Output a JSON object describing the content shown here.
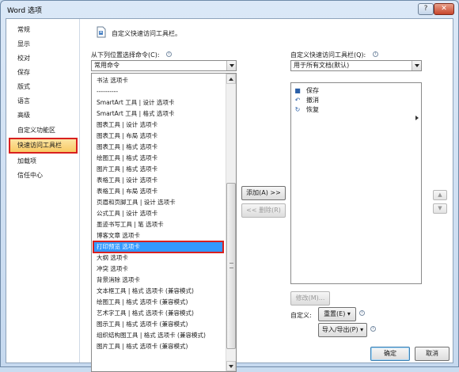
{
  "window": {
    "title": "Word 选项",
    "help_label": "?",
    "close_label": "✕"
  },
  "nav": {
    "items": [
      {
        "label": "常规",
        "selected": false
      },
      {
        "label": "显示",
        "selected": false
      },
      {
        "label": "校对",
        "selected": false
      },
      {
        "label": "保存",
        "selected": false
      },
      {
        "label": "版式",
        "selected": false
      },
      {
        "label": "语言",
        "selected": false
      },
      {
        "label": "高级",
        "selected": false
      },
      {
        "label": "自定义功能区",
        "selected": false
      },
      {
        "label": "快速访问工具栏",
        "selected": true
      },
      {
        "label": "加载项",
        "selected": false
      },
      {
        "label": "信任中心",
        "selected": false
      }
    ]
  },
  "header": {
    "title": "自定义快速访问工具栏。"
  },
  "left": {
    "choose_label": "从下列位置选择命令(C):",
    "choose_value": "常用命令",
    "list_items": [
      {
        "label": "书法 选项卡",
        "selected": false
      },
      {
        "label": "----------",
        "selected": false
      },
      {
        "label": "SmartArt 工具 | 设计 选项卡",
        "selected": false
      },
      {
        "label": "SmartArt 工具 | 格式 选项卡",
        "selected": false
      },
      {
        "label": "图表工具 | 设计 选项卡",
        "selected": false
      },
      {
        "label": "图表工具 | 布局 选项卡",
        "selected": false
      },
      {
        "label": "图表工具 | 格式 选项卡",
        "selected": false
      },
      {
        "label": "绘图工具 | 格式 选项卡",
        "selected": false
      },
      {
        "label": "图片工具 | 格式 选项卡",
        "selected": false
      },
      {
        "label": "表格工具 | 设计 选项卡",
        "selected": false
      },
      {
        "label": "表格工具 | 布局 选项卡",
        "selected": false
      },
      {
        "label": "页眉和页脚工具 | 设计 选项卡",
        "selected": false
      },
      {
        "label": "公式工具 | 设计 选项卡",
        "selected": false
      },
      {
        "label": "墨迹书写工具 | 笔 选项卡",
        "selected": false
      },
      {
        "label": "博客文章 选项卡",
        "selected": false
      },
      {
        "label": "打印预览 选项卡",
        "selected": true
      },
      {
        "label": "大纲 选项卡",
        "selected": false
      },
      {
        "label": "冲突 选项卡",
        "selected": false
      },
      {
        "label": "背景消除 选项卡",
        "selected": false
      },
      {
        "label": "文本框工具 | 格式 选项卡 (兼容模式)",
        "selected": false
      },
      {
        "label": "绘图工具 | 格式 选项卡 (兼容模式)",
        "selected": false
      },
      {
        "label": "艺术字工具 | 格式 选项卡 (兼容模式)",
        "selected": false
      },
      {
        "label": "图示工具 | 格式 选项卡 (兼容模式)",
        "selected": false
      },
      {
        "label": "组织结构图工具 | 格式 选项卡 (兼容模式)",
        "selected": false
      },
      {
        "label": "图片工具 | 格式 选项卡 (兼容模式)",
        "selected": false
      }
    ]
  },
  "middle": {
    "add_label": "添加(A) >>",
    "remove_label": "<< 删除(R)"
  },
  "right": {
    "customize_label": "自定义快速访问工具栏(Q):",
    "customize_value": "用于所有文档(默认)",
    "qat_items": [
      {
        "label": "保存",
        "icon": "save-icon",
        "glyph": "■"
      },
      {
        "label": "撤消",
        "icon": "undo-icon",
        "glyph": "↶"
      },
      {
        "label": "恢复",
        "icon": "redo-icon",
        "glyph": "↻"
      }
    ],
    "modify_label": "修改(M)...",
    "customize_text": "自定义:",
    "reset_label": "重置(E) ▾",
    "import_export_label": "导入/导出(P) ▾"
  },
  "footer": {
    "ok_label": "确定",
    "cancel_label": "取消"
  },
  "colors": {
    "accent_selected": "#3399ff",
    "highlight_outline": "#d9201f",
    "nav_selected": "#f8c860"
  }
}
